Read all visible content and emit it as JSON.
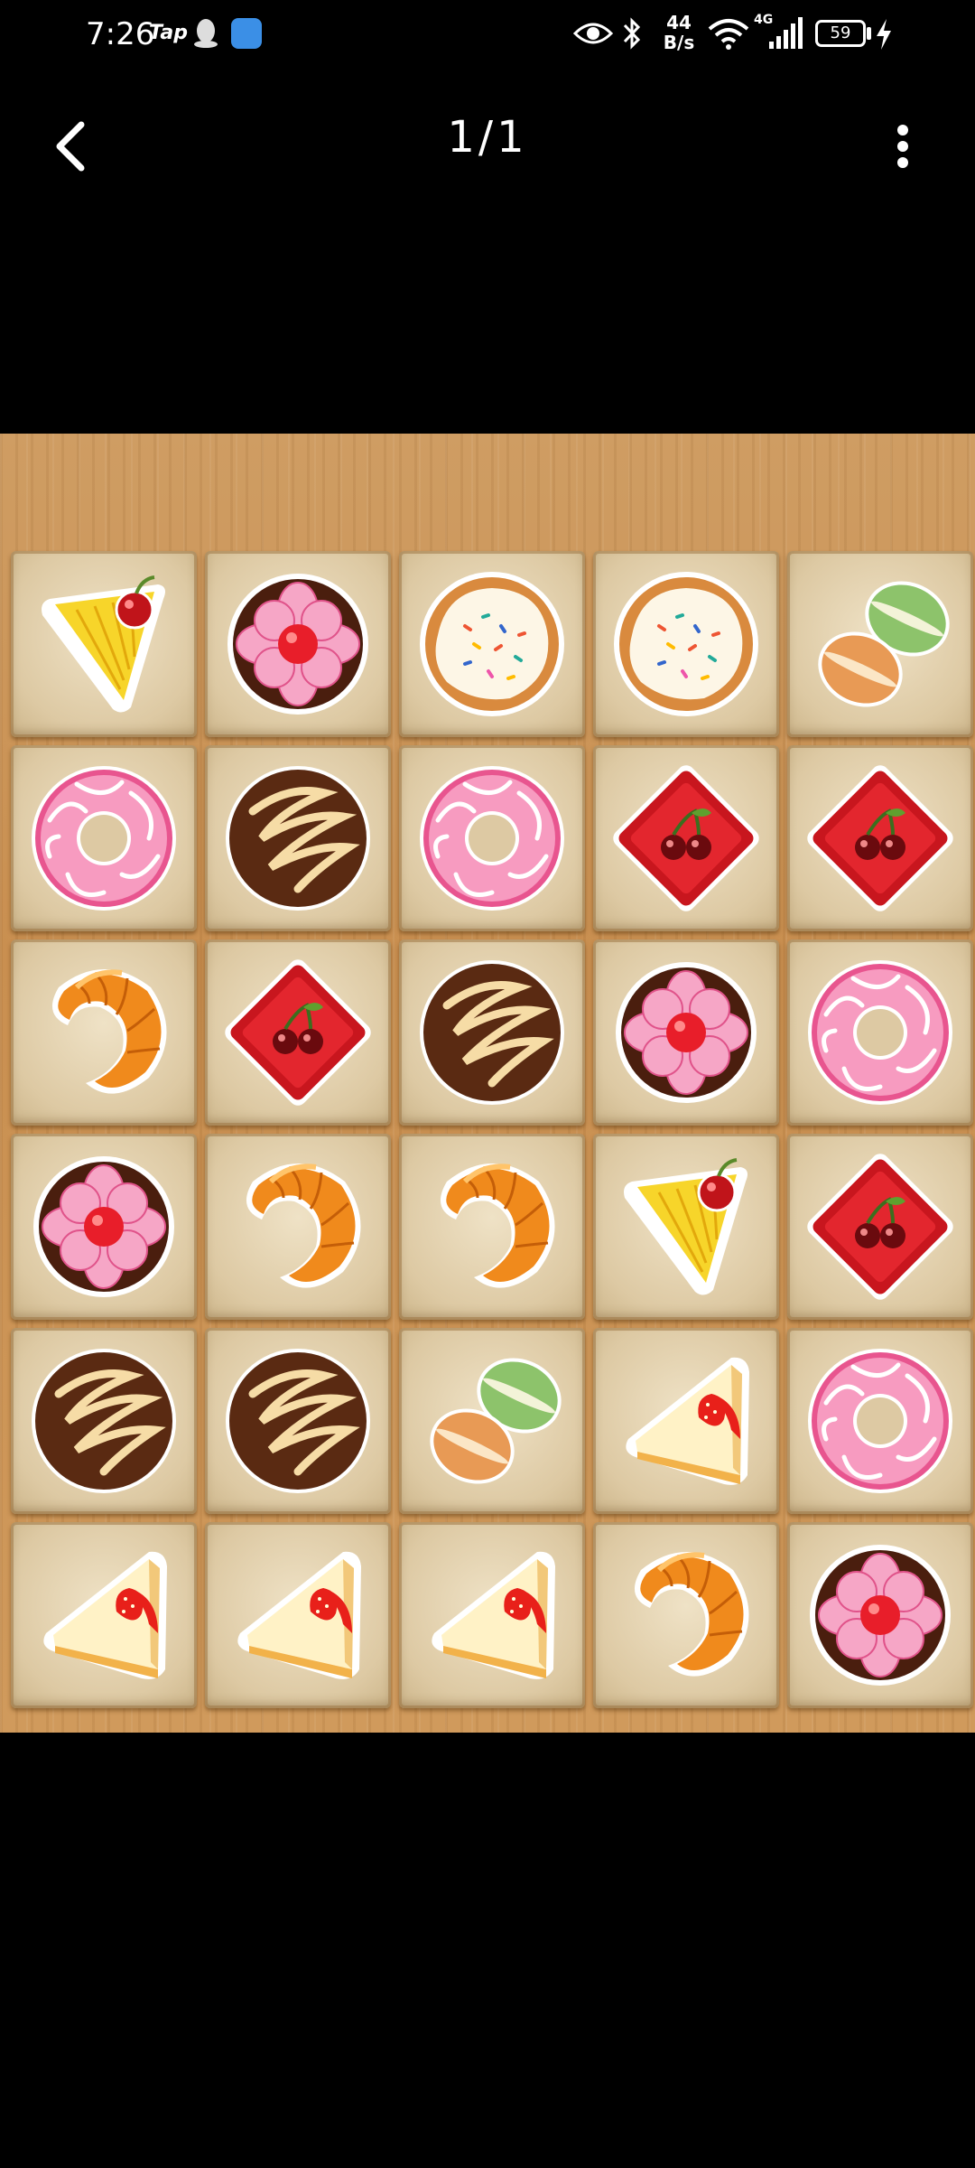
{
  "status_bar": {
    "time": "7:26",
    "app_label": "Tap",
    "net_speed_value": "44",
    "net_speed_unit": "B/s",
    "network_type": "4G",
    "battery_level": "59",
    "icons": [
      "qq-penguin-icon",
      "browser-icon",
      "eye-icon",
      "bluetooth-icon",
      "wifi-icon",
      "signal-icon",
      "charging-bolt-icon"
    ]
  },
  "header": {
    "page_counter": "1/1",
    "back_icon": "chevron-left-icon",
    "more_icon": "more-vertical-icon"
  },
  "board": {
    "rows": 6,
    "cols": 5,
    "tiles": [
      [
        "pineapple-cake",
        "flower-tart",
        "sprinkle-cookie",
        "sprinkle-cookie",
        "macarons"
      ],
      [
        "pink-donut",
        "chocolate-cookie",
        "pink-donut",
        "cherry-jelly",
        "cherry-jelly"
      ],
      [
        "croissant",
        "cherry-jelly",
        "chocolate-cookie",
        "flower-tart",
        "pink-donut"
      ],
      [
        "flower-tart",
        "croissant",
        "croissant",
        "pineapple-cake",
        "cherry-jelly"
      ],
      [
        "chocolate-cookie",
        "chocolate-cookie",
        "macarons",
        "strawberry-cheesecake",
        "pink-donut"
      ],
      [
        "strawberry-cheesecake",
        "strawberry-cheesecake",
        "strawberry-cheesecake",
        "croissant",
        "flower-tart"
      ]
    ]
  }
}
